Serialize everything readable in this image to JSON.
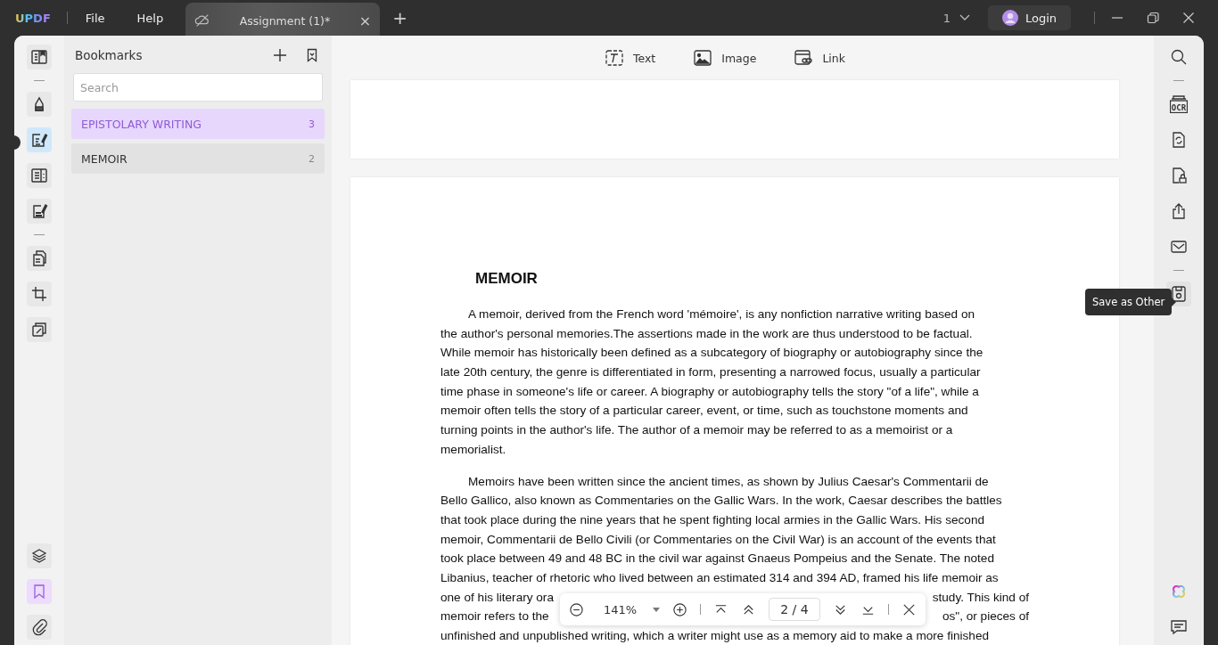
{
  "app": {
    "logo": "UPDF",
    "menu": [
      "File",
      "Help"
    ]
  },
  "tabs": [
    {
      "label": "Assignment (1)*",
      "selected": true,
      "close": "×"
    }
  ],
  "new_tab": "+",
  "page_indicator": "1",
  "login": "Login",
  "left_tools": [
    {
      "kind": "reader",
      "selected": false
    },
    {
      "kind": "divider"
    },
    {
      "kind": "highlight",
      "selected": false
    },
    {
      "kind": "edit",
      "selected": true
    },
    {
      "kind": "organize",
      "selected": false
    },
    {
      "kind": "form",
      "selected": false
    },
    {
      "kind": "divider"
    },
    {
      "kind": "pages",
      "selected": false
    },
    {
      "kind": "crop",
      "selected": false
    },
    {
      "kind": "copy",
      "selected": false
    }
  ],
  "left_bottom_tools": [
    {
      "kind": "layers",
      "selected": false
    },
    {
      "kind": "bookmark",
      "selected": true
    },
    {
      "kind": "attachment",
      "selected": false
    }
  ],
  "bookmarks": {
    "title": "Bookmarks",
    "search": {
      "placeholder": "Search"
    },
    "items": [
      {
        "label": "EPISTOLARY WRITING",
        "count": "3",
        "selected": true
      },
      {
        "label": "MEMOIR",
        "count": "2",
        "selected": false
      }
    ]
  },
  "edit_toolbar": [
    {
      "kind": "text",
      "label": "Text"
    },
    {
      "kind": "image",
      "label": "Image"
    },
    {
      "kind": "link",
      "label": "Link"
    }
  ],
  "document": {
    "heading": "MEMOIR",
    "paragraphs": [
      {
        "lines": [
          [
            "A memoir, derived from the French word 'mémoire', is any nonfiction narrative writing based on"
          ],
          [
            "the author's personal memories.The assertions made in the work are thus understood to be factual."
          ],
          [
            "While memoir has historically been defined as a subcategory of biography or autobiography since the"
          ],
          [
            "late 20th century, the genre is differentiated in form, presenting a narrowed focus, usually a particular"
          ],
          [
            "time phase in someone's life or career. A biography or autobiography tells the story \"of a life\", while a"
          ],
          [
            "memoir often tells the story of a particular career, event, or time, such as touchstone moments and"
          ],
          [
            "turning points in the author's life. The author of a memoir may be referred to as a memoirist or a"
          ],
          [
            "memorialist."
          ]
        ]
      },
      {
        "lines": [
          [
            "Memoirs have been written since the ancient times, as shown by Julius Caesar's Commentarii de"
          ],
          [
            "Bello Gallico, also known as Commentaries on the Gallic Wars. In the work, Caesar describes the battles"
          ],
          [
            "that took place during the nine years that he spent fighting local armies in the Gallic Wars. His second"
          ],
          [
            "memoir, Commentarii de Bello Civili (or Commentaries on the Civil War) is an account of the events that"
          ],
          [
            "took place between 49 and 48 BC in the civil war against Gnaeus Pompeius and the Senate. The noted"
          ],
          [
            "Libanius, teacher of rhetoric who lived between an estimated 314 and 394 AD, framed his life memoir as"
          ],
          [
            "one of his literary ora",
            "study. This kind of"
          ],
          [
            "memoir refers to the",
            "os\", or pieces of"
          ],
          [
            "unfinished and unpublished writing, which a writer might use as a memory aid to make a more finished"
          ]
        ]
      }
    ]
  },
  "right_tools": [
    {
      "kind": "search"
    },
    {
      "kind": "divider"
    },
    {
      "kind": "ocr",
      "label": "OCR"
    },
    {
      "kind": "convert"
    },
    {
      "kind": "protect"
    },
    {
      "kind": "share"
    },
    {
      "kind": "email"
    },
    {
      "kind": "divider"
    },
    {
      "kind": "save"
    }
  ],
  "right_bottom_tools": [
    {
      "kind": "ai"
    },
    {
      "kind": "comment"
    }
  ],
  "tooltip": "Save as Other",
  "page_nav": {
    "zoom": "141%",
    "page": "2 / 4"
  }
}
